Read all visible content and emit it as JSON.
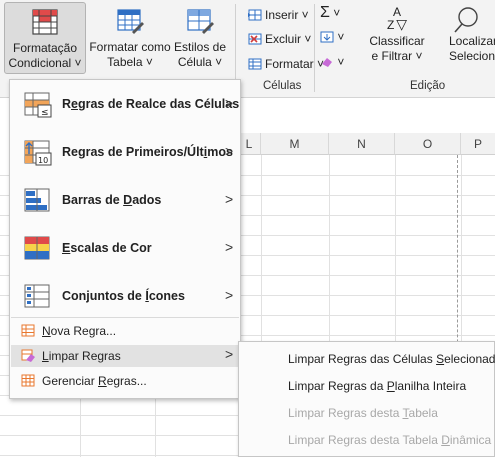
{
  "ribbon": {
    "cond_format_line1": "Formatação",
    "cond_format_line2": "Condicional ˅",
    "format_table_line1": "Formatar como",
    "format_table_line2": "Tabela ˅",
    "cell_styles_line1": "Estilos de",
    "cell_styles_line2": "Célula ˅",
    "insert": "Inserir ˅",
    "delete": "Excluir ˅",
    "format": "Formatar ˅",
    "cells_group": "Células",
    "sum_chevron": "˅",
    "fill_chevron": "˅",
    "clear_chevron": "˅",
    "sort_line1": "Classificar",
    "sort_line2": "e Filtrar ˅",
    "find_line1": "Localizar",
    "find_line2": "Selecionar",
    "edit_group": "Edição"
  },
  "sheet": {
    "columns": [
      "L",
      "M",
      "N",
      "O",
      "P"
    ]
  },
  "menu": {
    "highlight_rules": {
      "pre": "R",
      "u": "e",
      "post": "gras de Realce das Células"
    },
    "top_bottom_rules": {
      "pre": "Regras de Primeiros/Últ",
      "u": "i",
      "post": "mos"
    },
    "data_bars": {
      "pre": "Barras de ",
      "u": "D",
      "post": "ados"
    },
    "color_scales": {
      "pre": "",
      "u": "E",
      "post": "scalas de Cor"
    },
    "icon_sets": {
      "pre": "Conjuntos de ",
      "u": "Í",
      "post": "cones"
    },
    "new_rule": {
      "pre": "",
      "u": "N",
      "post": "ova Regra..."
    },
    "clear_rules": {
      "pre": "",
      "u": "L",
      "post": "impar Regras"
    },
    "manage_rules": {
      "pre": "Gerenciar ",
      "u": "R",
      "post": "egras..."
    },
    "arrow": ">"
  },
  "submenu": {
    "clear_selected": {
      "pre": "Limpar Regras das Células ",
      "u": "S",
      "post": "elecionadas"
    },
    "clear_sheet": {
      "pre": "Limpar Regras da ",
      "u": "P",
      "post": "lanilha Inteira"
    },
    "clear_table": {
      "pre": "Limpar Regras desta ",
      "u": "T",
      "post": "abela"
    },
    "clear_pivot": {
      "pre": "Limpar Regras desta Tabela ",
      "u": "D",
      "post": "inâmica"
    }
  },
  "colors": {
    "accent_blue": "#2f6fc4",
    "orange": "#e8772e",
    "highlight": "#e2e2e2",
    "disabled": "#a8a8a8"
  }
}
